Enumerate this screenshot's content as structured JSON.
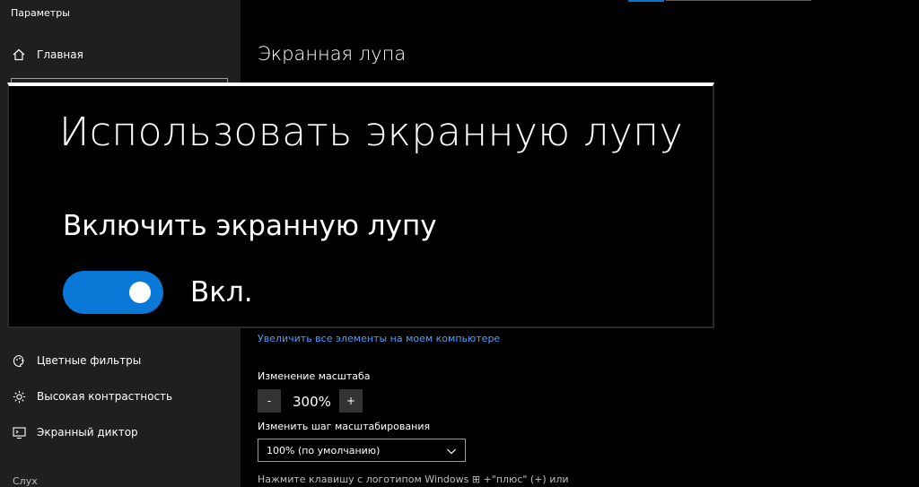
{
  "window": {
    "title": "Параметры"
  },
  "sidebar": {
    "home": {
      "label": "Главная",
      "icon": "home-icon"
    },
    "items": [
      {
        "label": "Цветные фильтры",
        "icon": "palette-icon"
      },
      {
        "label": "Высокая контрастность",
        "icon": "sun-icon"
      },
      {
        "label": "Экранный диктор",
        "icon": "narrator-icon"
      }
    ],
    "section_label": "Слух"
  },
  "main": {
    "title": "Экранная лупа",
    "magnifier_overlay": {
      "heading": "Использовать экранную лупу",
      "sub": "Включить экранную лупу",
      "toggle_state": "Вкл."
    },
    "link": "Увеличить все элементы на моем компьютере",
    "zoom": {
      "label": "Изменение масштаба",
      "minus": "-",
      "value": "300%",
      "plus": "+"
    },
    "step": {
      "label": "Изменить шаг масштабирования",
      "selected": "100% (по умолчанию)"
    },
    "hint": "Нажмите клавишу с логотипом Windows ⊞ +\"плюс\" (+) или"
  },
  "colors": {
    "accent": "#0078d7",
    "sidebar_bg": "#1f1f1f",
    "link": "#4aa0ff"
  }
}
